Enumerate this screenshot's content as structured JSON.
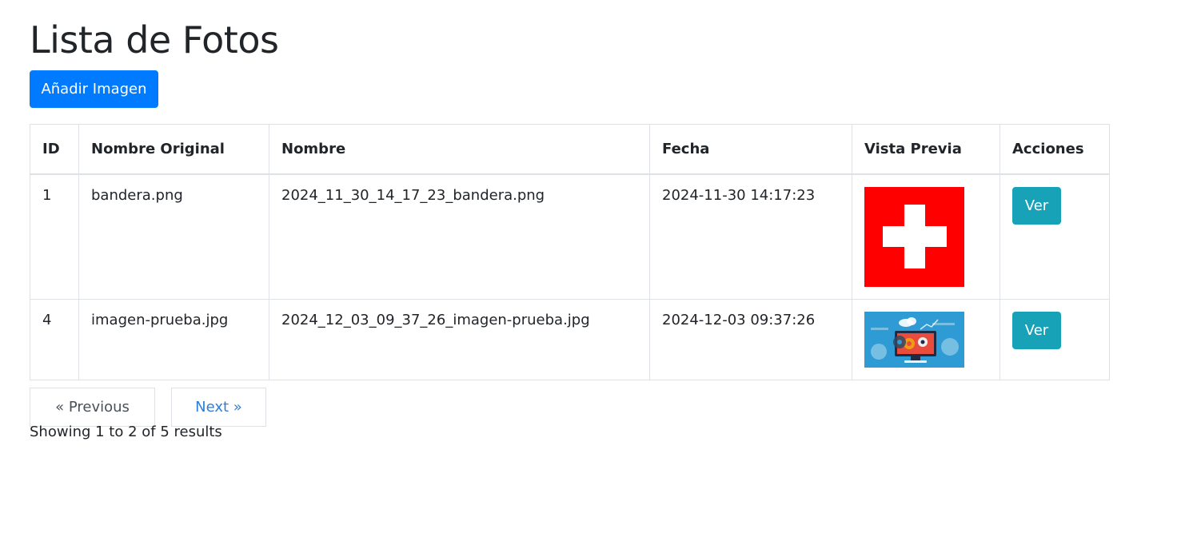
{
  "page": {
    "title": "Lista de Fotos",
    "add_button_label": "Añadir Imagen"
  },
  "table": {
    "headers": [
      "ID",
      "Nombre Original",
      "Nombre",
      "Fecha",
      "Vista Previa",
      "Acciones"
    ],
    "rows": [
      {
        "id": "1",
        "original_name": "bandera.png",
        "name": "2024_11_30_14_17_23_bandera.png",
        "date": "2024-11-30 14:17:23",
        "preview": "swiss-flag-image",
        "action_label": "Ver"
      },
      {
        "id": "4",
        "original_name": "imagen-prueba.jpg",
        "name": "2024_12_03_09_37_26_imagen-prueba.jpg",
        "date": "2024-12-03 09:37:26",
        "preview": "tech-illustration-image",
        "action_label": "Ver"
      }
    ]
  },
  "pagination": {
    "previous_label": "« Previous",
    "next_label": "Next »",
    "summary": "Showing 1 to 2 of 5 results"
  },
  "colors": {
    "primary": "#007bff",
    "info": "#17a2b8",
    "border": "#dee2e6",
    "text": "#212529",
    "link": "#2f7fd6",
    "flag_red": "#ff0000",
    "tech_bg": "#2e9bd4"
  }
}
